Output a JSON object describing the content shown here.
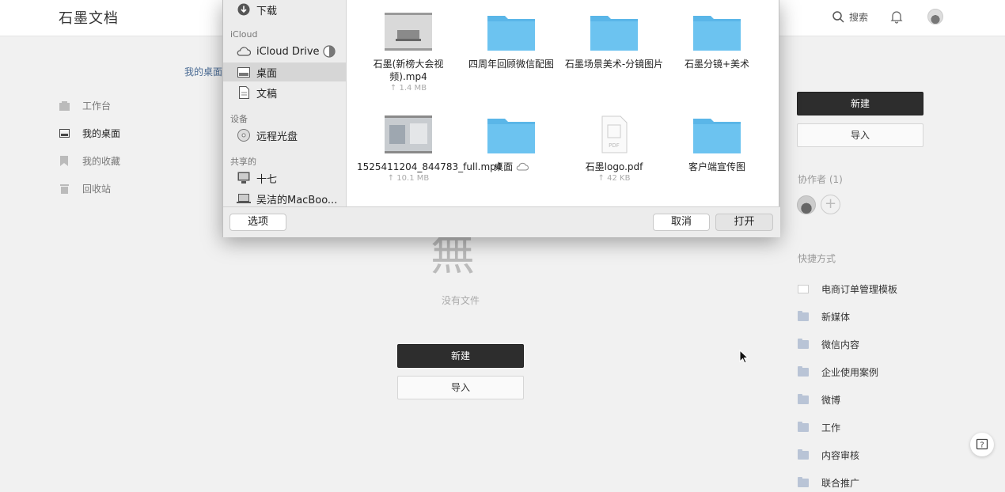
{
  "app": {
    "logo": "石墨文档"
  },
  "header": {
    "search_label": "搜索"
  },
  "breadcrumb": "我的桌面",
  "nav": [
    {
      "label": "工作台"
    },
    {
      "label": "我的桌面"
    },
    {
      "label": "我的收藏"
    },
    {
      "label": "回收站"
    }
  ],
  "empty": {
    "glyph": "無",
    "text": "没有文件",
    "new_label": "新建",
    "import_label": "导入"
  },
  "right_panel": {
    "new_label": "新建",
    "import_label": "导入",
    "collaborators_label": "协作者 (1)",
    "shortcuts_label": "快捷方式",
    "shortcuts": [
      {
        "label": "电商订单管理模板",
        "kind": "doc"
      },
      {
        "label": "新媒体",
        "kind": "folder"
      },
      {
        "label": "微信内容",
        "kind": "folder"
      },
      {
        "label": "企业使用案例",
        "kind": "folder"
      },
      {
        "label": "微博",
        "kind": "folder"
      },
      {
        "label": "工作",
        "kind": "folder"
      },
      {
        "label": "内容审核",
        "kind": "folder"
      },
      {
        "label": "联合推广",
        "kind": "folder"
      }
    ]
  },
  "dialog": {
    "sidebar": {
      "downloads": "下载",
      "icloud_section": "iCloud",
      "icloud_drive": "iCloud Drive",
      "desktop": "桌面",
      "documents": "文稿",
      "devices_section": "设备",
      "remote_disc": "远程光盘",
      "shared_section": "共享的",
      "shared_1": "十七",
      "shared_2": "吴洁的MacBoo..."
    },
    "files": [
      {
        "name": "石墨(新榜大会视频).mp4",
        "size": "↑ 1.4 MB",
        "kind": "video"
      },
      {
        "name": "四周年回顾微信配图",
        "size": "",
        "kind": "folder"
      },
      {
        "name": "石墨场景美术-分镜图片",
        "size": "",
        "kind": "folder"
      },
      {
        "name": "石墨分镜+美术",
        "size": "",
        "kind": "folder"
      },
      {
        "name": "1525411204_844783_full.mp4",
        "size": "↑ 10.1 MB",
        "kind": "video"
      },
      {
        "name": "桌面",
        "size": "",
        "kind": "folder"
      },
      {
        "name": "石墨logo.pdf",
        "size": "↑ 42 KB",
        "kind": "pdf"
      },
      {
        "name": "客户端宣传图",
        "size": "",
        "kind": "folder"
      }
    ],
    "options_label": "选项",
    "cancel_label": "取消",
    "open_label": "打开"
  },
  "colors": {
    "accent_dark": "#2d2d2d",
    "folder_blue": "#6cc3f0",
    "link": "#4a6b94"
  }
}
